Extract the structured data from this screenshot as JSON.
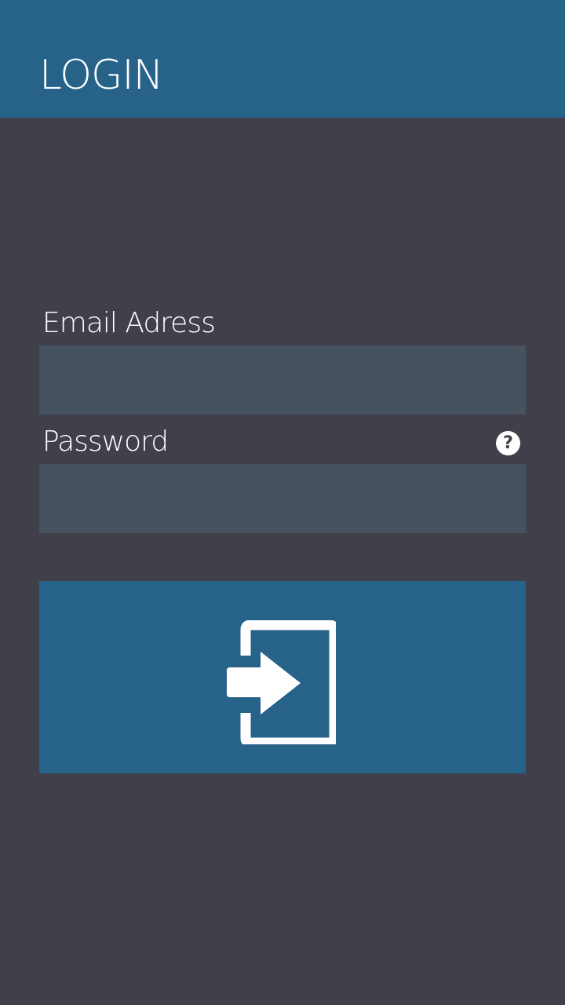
{
  "header": {
    "title": "LOGIN",
    "background_color": "#276289"
  },
  "form": {
    "email": {
      "label": "Email Adress",
      "value": "",
      "placeholder": ""
    },
    "password": {
      "label": "Password",
      "value": "",
      "placeholder": "",
      "help_icon": "question-mark-icon",
      "help_glyph": "?"
    },
    "submit": {
      "icon": "sign-in-arrow-icon",
      "background_color": "#276289"
    }
  },
  "colors": {
    "background": "#40404a",
    "input_background": "#46525f",
    "text": "#ffffff"
  }
}
